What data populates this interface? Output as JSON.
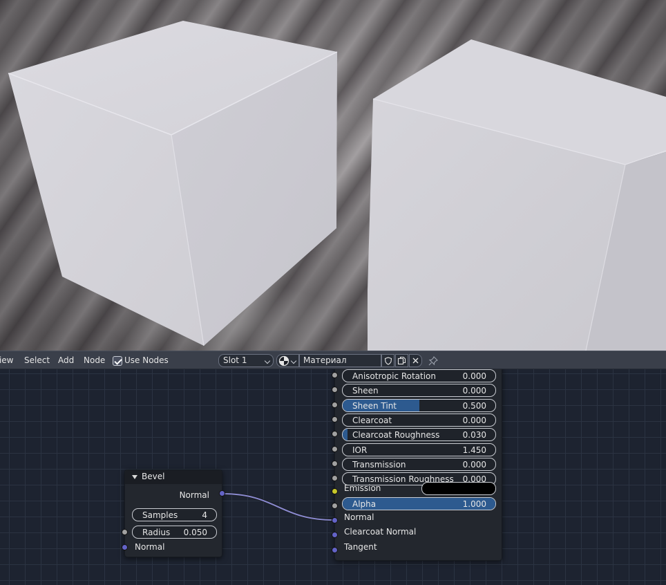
{
  "header": {
    "menu": [
      "View",
      "Select",
      "Add",
      "Node"
    ],
    "use_nodes_label": "Use Nodes",
    "slot": "Slot 1",
    "material_name": "Материал"
  },
  "bevel_node": {
    "title": "Bevel",
    "output": "Normal",
    "samples_label": "Samples",
    "samples_value": "4",
    "radius_label": "Radius",
    "radius_value": "0.050",
    "input_normal": "Normal"
  },
  "bsdf_node": {
    "fields": [
      {
        "label": "Anisotropic Rotation",
        "value": "0.000",
        "fill": 0.0
      },
      {
        "label": "Sheen",
        "value": "0.000",
        "fill": 0.0
      },
      {
        "label": "Sheen Tint",
        "value": "0.500",
        "fill": 0.5
      },
      {
        "label": "Clearcoat",
        "value": "0.000",
        "fill": 0.0
      },
      {
        "label": "Clearcoat Roughness",
        "value": "0.030",
        "fill": 0.03
      },
      {
        "label": "IOR",
        "value": "1.450",
        "fill": 0.0
      },
      {
        "label": "Transmission",
        "value": "0.000",
        "fill": 0.0
      },
      {
        "label": "Transmission Roughness",
        "value": "0.000",
        "fill": 0.0
      }
    ],
    "emission_label": "Emission",
    "emission_color": "#000000",
    "alpha_label": "Alpha",
    "alpha_value": "1.000",
    "alpha_fill": 1.0,
    "normal_label": "Normal",
    "clearcoat_normal_label": "Clearcoat Normal",
    "tangent_label": "Tangent"
  },
  "colors": {
    "accent_blue": "#2d5a8f",
    "vector_socket": "#6363c7",
    "float_socket": "#a1a1a1",
    "color_socket": "#c7c729",
    "link": "#8a8ad0"
  }
}
